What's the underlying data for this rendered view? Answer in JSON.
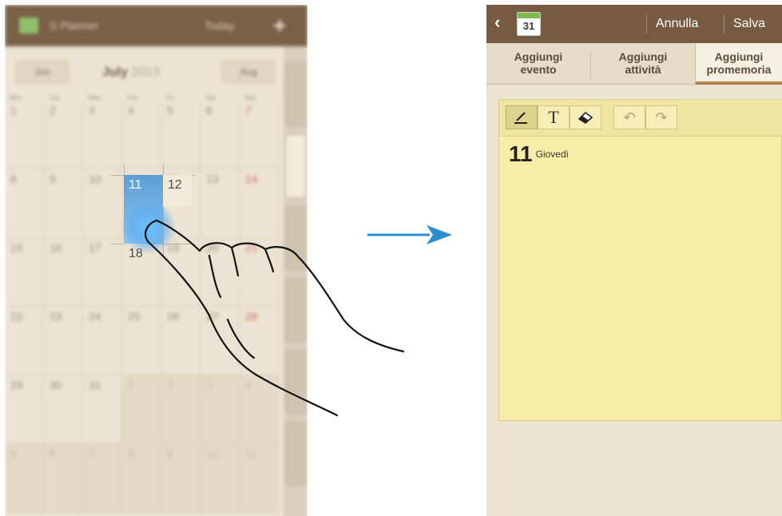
{
  "left_screen": {
    "app_title": "S Planner",
    "today_label": "Today",
    "add_label": "+",
    "prev_month": "Jun",
    "month": "July",
    "year": "2013",
    "next_month": "Aug",
    "weekdays": [
      "Mon",
      "Tue",
      "Wed",
      "Thu",
      "Fri",
      "Sat",
      "Sun"
    ],
    "weeks": [
      [
        "1",
        "2",
        "3",
        "4",
        "5",
        "6",
        "7"
      ],
      [
        "8",
        "9",
        "10",
        "11",
        "12",
        "13",
        "14"
      ],
      [
        "15",
        "16",
        "17",
        "18",
        "19",
        "20",
        "21"
      ],
      [
        "22",
        "23",
        "24",
        "25",
        "26",
        "27",
        "28"
      ],
      [
        "29",
        "30",
        "31",
        "1",
        "2",
        "3",
        "4"
      ],
      [
        "5",
        "6",
        "7",
        "8",
        "9",
        "10",
        "11"
      ]
    ],
    "selected_day": "11",
    "neighbor_day_right": "12",
    "neighbor_day_below": "18",
    "highlight_color": "#5d9fd6"
  },
  "right_screen": {
    "calendar_icon_day": "31",
    "cancel_label": "Annulla",
    "save_label": "Salva",
    "tabs": [
      {
        "line1": "Aggiungi",
        "line2": "evento"
      },
      {
        "line1": "Aggiungi",
        "line2": "attività"
      },
      {
        "line1": "Aggiungi",
        "line2": "promemoria"
      }
    ],
    "active_tab": 2,
    "date_number": "11",
    "weekday": "Giovedì",
    "note_color": "#f7eda6",
    "tools": [
      "pen-icon",
      "text-icon",
      "eraser-icon",
      "undo-icon",
      "redo-icon"
    ]
  }
}
